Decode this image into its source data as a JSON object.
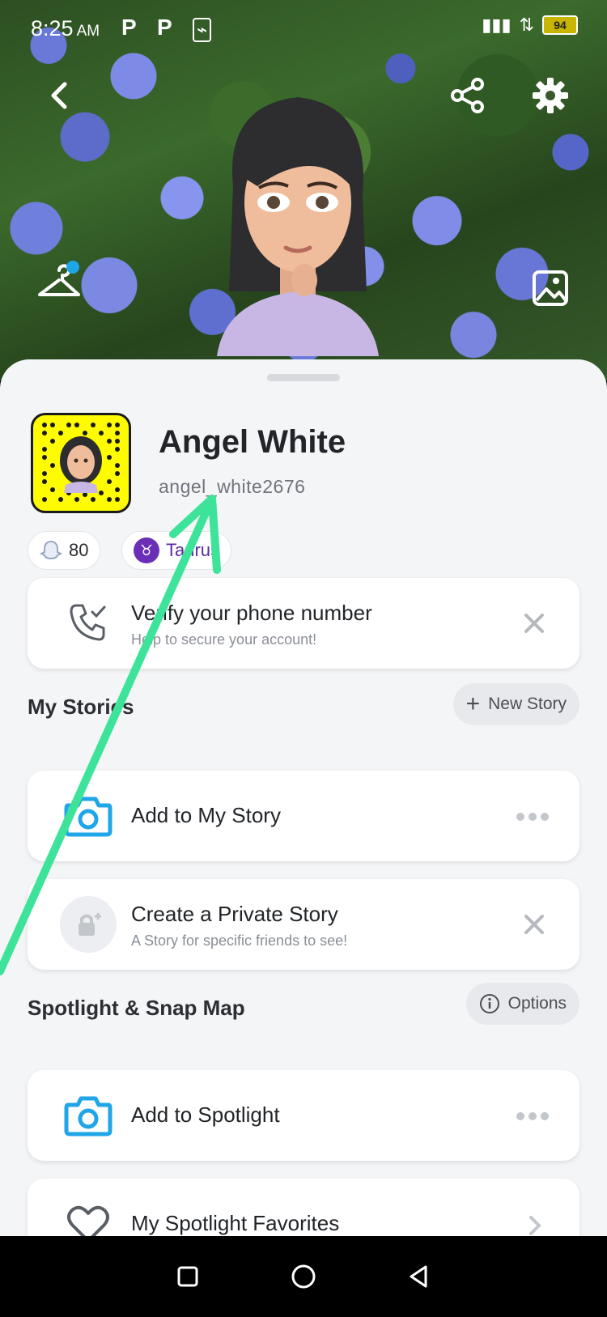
{
  "status_bar": {
    "time": "8:25",
    "ampm": "AM",
    "battery": "94"
  },
  "profile": {
    "display_name": "Angel White",
    "username": "angel_white2676",
    "snap_score": "80",
    "zodiac": "Taurus"
  },
  "verify_card": {
    "title": "Verify your phone number",
    "subtitle": "Help to secure your account!"
  },
  "my_stories": {
    "title": "My Stories",
    "new_story_label": "New Story",
    "items": [
      {
        "title": "Add to My Story"
      },
      {
        "title": "Create a Private Story",
        "subtitle": "A Story for specific friends to see!"
      }
    ]
  },
  "spotlight": {
    "title": "Spotlight & Snap Map",
    "options_label": "Options",
    "items": [
      {
        "title": "Add to Spotlight"
      },
      {
        "title": "My Spotlight Favorites"
      }
    ]
  },
  "colors": {
    "accent_blue": "#1fa6e8",
    "arrow_green": "#3ee39a",
    "snapcode_yellow": "#fffc00"
  }
}
